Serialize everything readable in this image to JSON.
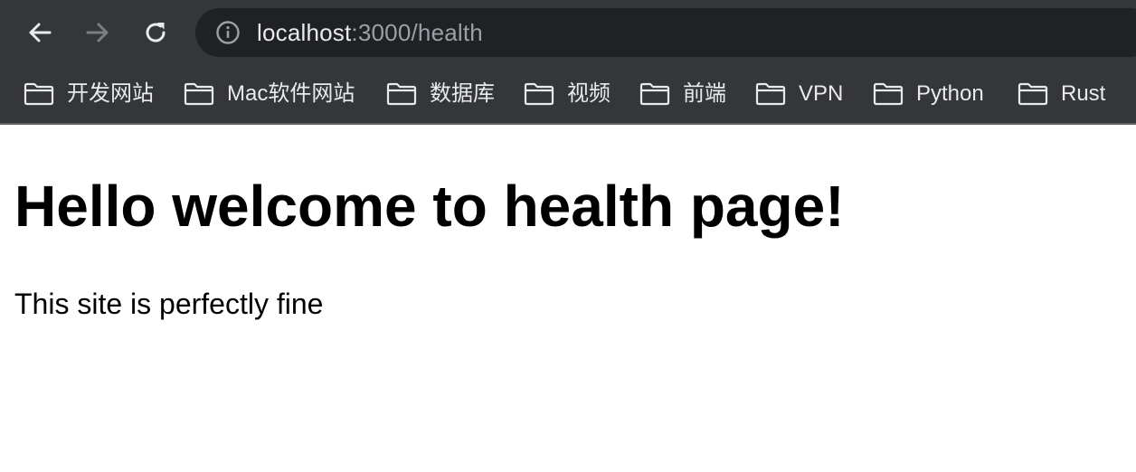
{
  "browser": {
    "address_bar": {
      "host": "localhost",
      "path": ":3000/health"
    },
    "icons": {
      "back": "back-arrow-icon",
      "forward": "forward-arrow-icon",
      "reload": "reload-icon",
      "info": "info-icon",
      "bookmark_folder": "folder-icon"
    },
    "colors": {
      "chrome_background": "#35363a",
      "omnibox_background": "#202124",
      "url_host": "#e8eaed",
      "url_path": "#9aa0a6",
      "page_background": "#ffffff"
    }
  },
  "bookmarks": [
    {
      "label": "开发网站"
    },
    {
      "label": "Mac软件网站"
    },
    {
      "label": "数据库"
    },
    {
      "label": "视频"
    },
    {
      "label": "前端"
    },
    {
      "label": "VPN"
    },
    {
      "label": "Python"
    },
    {
      "label": "Rust"
    }
  ],
  "page": {
    "heading": "Hello welcome to health page!",
    "text": "This site is perfectly fine"
  }
}
